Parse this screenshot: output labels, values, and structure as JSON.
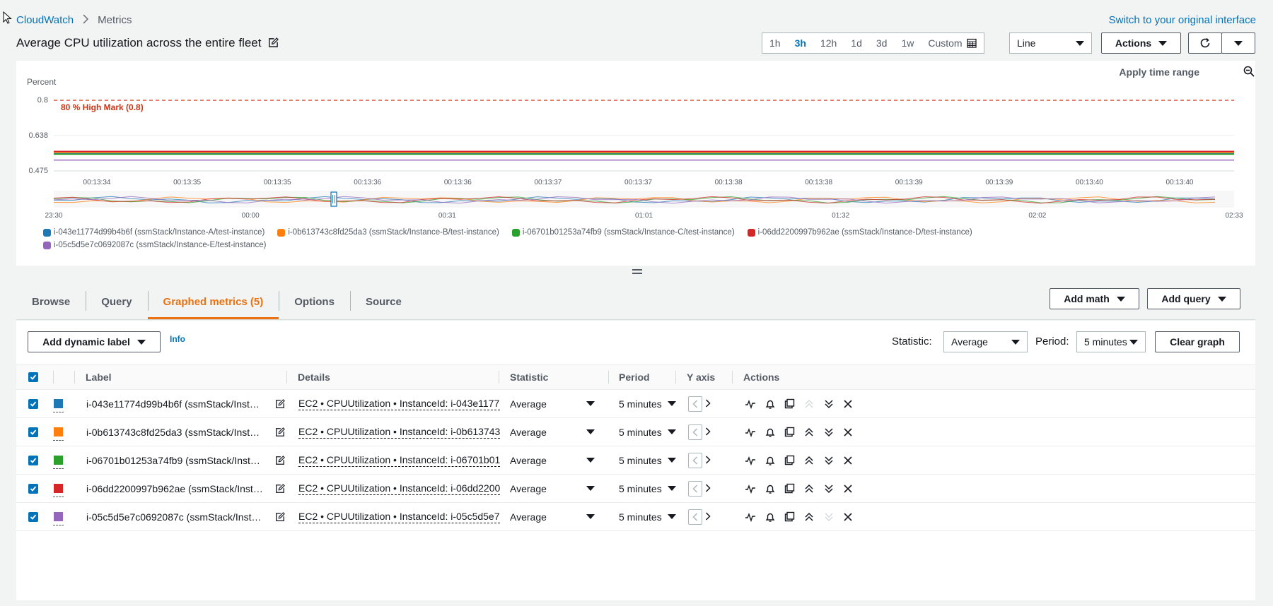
{
  "breadcrumb": {
    "root": "CloudWatch",
    "current": "Metrics"
  },
  "switch_link": "Switch to your original interface",
  "title": "Average CPU utilization across the entire fleet",
  "time_range": {
    "options": [
      "1h",
      "3h",
      "12h",
      "1d",
      "3d",
      "1w"
    ],
    "active": "3h",
    "custom_label": "Custom"
  },
  "graph_type": "Line",
  "actions_label": "Actions",
  "apply_time_range": "Apply time range",
  "chart_data": {
    "type": "line",
    "ylabel": "Percent",
    "y_ticks": [
      "0.8",
      "0.638",
      "0.475"
    ],
    "threshold": {
      "label": "80 % High Mark (0.8)",
      "value": 0.8,
      "color": "#d13212"
    },
    "x_ticks": [
      "00:13:34",
      "00:13:35",
      "00:13:35",
      "00:13:36",
      "00:13:36",
      "00:13:37",
      "00:13:37",
      "00:13:38",
      "00:13:38",
      "00:13:39",
      "00:13:39",
      "00:13:40",
      "00:13:40"
    ],
    "overview_ticks": [
      "23:30",
      "00:00",
      "00:31",
      "01:01",
      "01:32",
      "02:02",
      "02:33"
    ],
    "series": [
      {
        "name": "i-043e11774d99b4b6f (ssmStack/Instance-A/test-instance)",
        "color": "#1f77b4",
        "value": 0.555
      },
      {
        "name": "i-0b613743c8fd25da3 (ssmStack/Instance-B/test-instance)",
        "color": "#ff7f0e",
        "value": 0.56
      },
      {
        "name": "i-06701b01253a74fb9 (ssmStack/Instance-C/test-instance)",
        "color": "#2ca02c",
        "value": 0.552
      },
      {
        "name": "i-06dd2200997b962ae (ssmStack/Instance-D/test-instance)",
        "color": "#d62728",
        "value": 0.565
      },
      {
        "name": "i-05c5d5e7c0692087c (ssmStack/Instance-E/test-instance)",
        "color": "#9467bd",
        "value": 0.525
      }
    ]
  },
  "tabs": [
    {
      "label": "Browse",
      "active": false
    },
    {
      "label": "Query",
      "active": false
    },
    {
      "label": "Graphed metrics (5)",
      "active": true
    },
    {
      "label": "Options",
      "active": false
    },
    {
      "label": "Source",
      "active": false
    }
  ],
  "add_math": "Add math",
  "add_query": "Add query",
  "add_dynamic_label": "Add dynamic label",
  "info": "Info",
  "statistic_label": "Statistic:",
  "statistic_value": "Average",
  "period_label": "Period:",
  "period_value": "5 minutes",
  "clear_graph": "Clear graph",
  "table": {
    "headers": [
      "Label",
      "Details",
      "Statistic",
      "Period",
      "Y axis",
      "Actions"
    ],
    "rows": [
      {
        "label": "i-043e11774d99b4b6f (ssmStack/Inst…",
        "details": "EC2 • CPUUtilization • InstanceId: i-043e1177",
        "statistic": "Average",
        "period": "5 minutes",
        "color": "#1f77b4"
      },
      {
        "label": "i-0b613743c8fd25da3 (ssmStack/Inst…",
        "details": "EC2 • CPUUtilization • InstanceId: i-0b613743",
        "statistic": "Average",
        "period": "5 minutes",
        "color": "#ff7f0e"
      },
      {
        "label": "i-06701b01253a74fb9 (ssmStack/Inst…",
        "details": "EC2 • CPUUtilization • InstanceId: i-06701b01",
        "statistic": "Average",
        "period": "5 minutes",
        "color": "#2ca02c"
      },
      {
        "label": "i-06dd2200997b962ae (ssmStack/Inst…",
        "details": "EC2 • CPUUtilization • InstanceId: i-06dd2200",
        "statistic": "Average",
        "period": "5 minutes",
        "color": "#d62728"
      },
      {
        "label": "i-05c5d5e7c0692087c (ssmStack/Inst…",
        "details": "EC2 • CPUUtilization • InstanceId: i-05c5d5e7",
        "statistic": "Average",
        "period": "5 minutes",
        "color": "#9467bd"
      }
    ]
  }
}
